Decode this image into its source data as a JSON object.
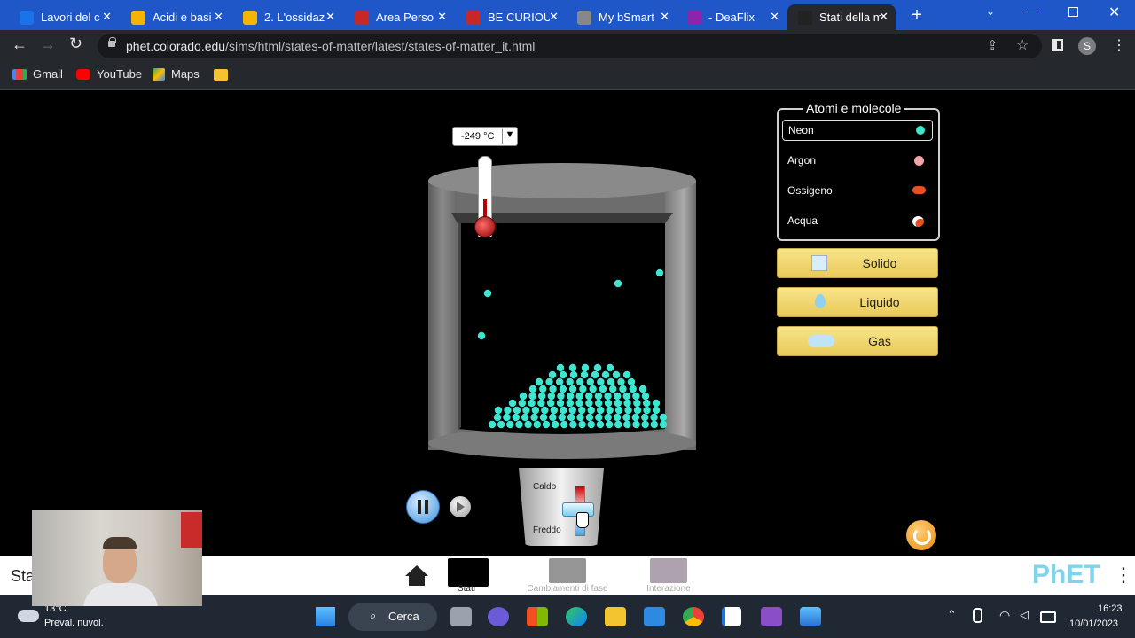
{
  "browser": {
    "tabs": [
      {
        "title": "Lavori del c",
        "icon": "classroom-icon",
        "color": "#1a73e8"
      },
      {
        "title": "Acidi e basi",
        "icon": "slides-icon",
        "color": "#f4b400"
      },
      {
        "title": "2. L'ossidaz",
        "icon": "slides-icon",
        "color": "#f4b400"
      },
      {
        "title": "Area Perso",
        "icon": "app-icon",
        "color": "#c62828"
      },
      {
        "title": "BE CURIOU",
        "icon": "app-icon",
        "color": "#c62828"
      },
      {
        "title": "My bSmart",
        "icon": "bsmart-icon",
        "color": "#888"
      },
      {
        "title": "- DeaFlix",
        "icon": "deaflix-icon",
        "color": "#8e24aa"
      },
      {
        "title": "Stati della m",
        "icon": "phet-icon",
        "color": "#222",
        "active": true
      }
    ],
    "url_domain": "phet.colorado.edu",
    "url_path": "/sims/html/states-of-matter/latest/states-of-matter_it.html",
    "profile_initial": "S",
    "bookmarks": [
      "Gmail",
      "YouTube",
      "Maps"
    ]
  },
  "sim": {
    "thermometer_readout": "-249 °C",
    "thermometer_dropdown": "▼",
    "heater": {
      "hot_label": "Caldo",
      "cold_label": "Freddo"
    },
    "atoms_panel": {
      "title": "Atomi e molecole",
      "items": [
        {
          "label": "Neon",
          "color": "#3ee6d2",
          "selected": true
        },
        {
          "label": "Argon",
          "color": "#f4a4a8"
        },
        {
          "label": "Ossigeno",
          "color": "#e8501e"
        },
        {
          "label": "Acqua",
          "color": "#e8501e"
        }
      ]
    },
    "state_buttons": [
      "Solido",
      "Liquido",
      "Gas"
    ],
    "particle_color": "#3ee6d2"
  },
  "nav": {
    "sim_title_partial": "Sta",
    "screens": [
      {
        "label": "Stati",
        "active": true
      },
      {
        "label": "Cambiamenti di fase",
        "active": false
      },
      {
        "label": "Interazione",
        "active": false
      }
    ],
    "brand": "PhET"
  },
  "taskbar": {
    "weather_temp": "13°C",
    "weather_desc": "Preval. nuvol.",
    "search_label": "Cerca",
    "time": "16:23",
    "date": "10/01/2023"
  }
}
